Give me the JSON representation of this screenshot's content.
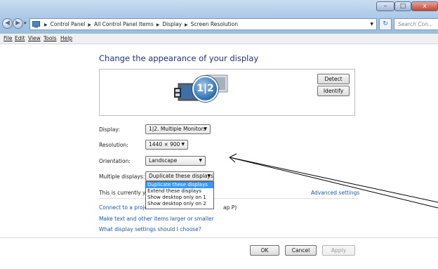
{
  "window": {
    "minimize_glyph": "–",
    "maximize_glyph": "□",
    "close_glyph": "x"
  },
  "nav": {
    "back_glyph": "◀",
    "forward_glyph": "▶",
    "history_glyph": "▾",
    "breadcrumb": [
      "Control Panel",
      "All Control Panel Items",
      "Display",
      "Screen Resolution"
    ],
    "breadcrumb_sep": "▶",
    "refresh_glyph": "↻",
    "search_placeholder": "Search Con..."
  },
  "menu": [
    "File",
    "Edit",
    "View",
    "Tools",
    "Help"
  ],
  "main": {
    "title": "Change the appearance of your display",
    "monitor_badge": "1|2",
    "detect_label": "Detect",
    "identify_label": "Identify",
    "display_label": "Display:",
    "display_value": "1|2. Multiple Monitors",
    "resolution_label": "Resolution:",
    "resolution_value": "1440 × 900",
    "orientation_label": "Orientation:",
    "orientation_value": "Landscape",
    "multiple_label": "Multiple displays:",
    "multiple_value": "Duplicate these displays",
    "multiple_options": [
      "Duplicate these displays",
      "Extend these displays",
      "Show desktop only on 1",
      "Show desktop only on 2"
    ],
    "current_text": "This is currently you",
    "advanced_link": "Advanced settings",
    "connect_link": "Connect to a projec",
    "connect_suffix": "ap P)",
    "text_size_link": "Make text and other items larger or smaller",
    "which_settings_link": "What display settings should I choose?"
  },
  "footer": {
    "ok_label": "OK",
    "cancel_label": "Cancel",
    "apply_label": "Apply"
  },
  "colors": {
    "title_blue": "#1e3287",
    "link_blue": "#1c57b3",
    "highlight": "#3399ff",
    "close_red": "#c8432e"
  }
}
